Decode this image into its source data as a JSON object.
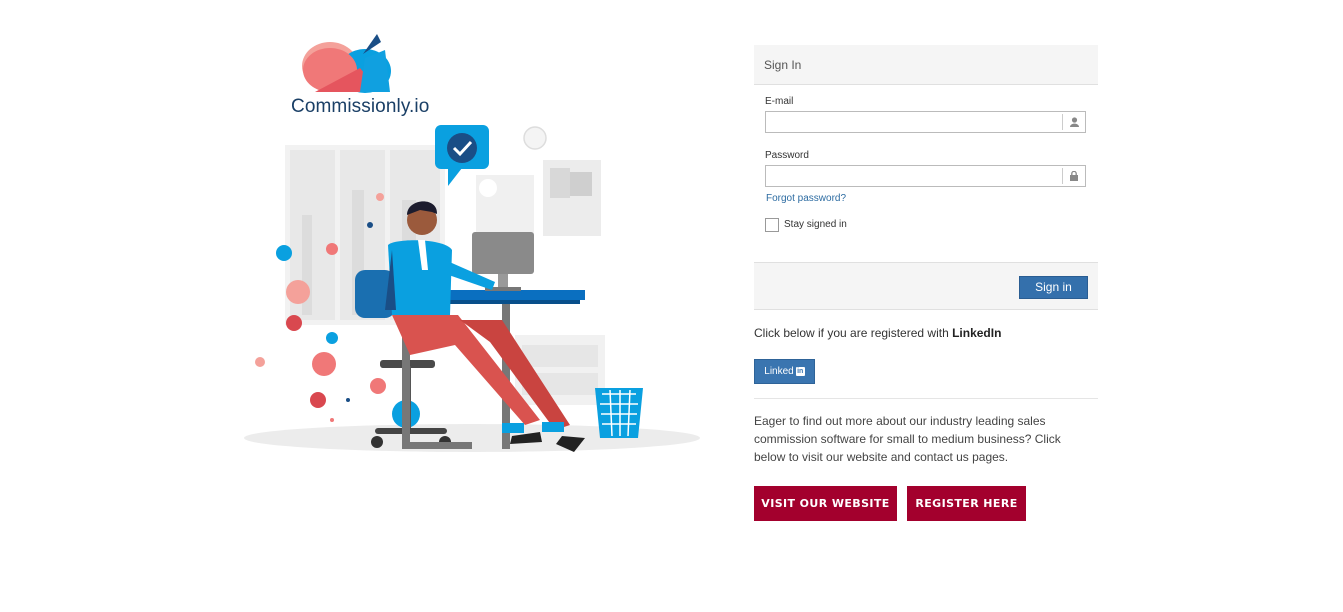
{
  "brand": {
    "name": "Commissionly.io",
    "logo_icon": "cloud-logo-icon"
  },
  "signin": {
    "header": "Sign In",
    "email_label": "E-mail",
    "email_value": "",
    "password_label": "Password",
    "password_value": "",
    "forgot_link": "Forgot password?",
    "stay_signed_in_label": "Stay signed in",
    "stay_signed_in_checked": false,
    "submit_label": "Sign in"
  },
  "linkedin": {
    "prompt_prefix": "Click below if you are registered with ",
    "prompt_bold": "LinkedIn",
    "button_label": "Linked",
    "badge": "in"
  },
  "info": {
    "text": "Eager to find out more about our industry leading sales commission software for small to medium business? Click below to visit our website and contact us pages."
  },
  "actions": {
    "visit_label": "VISIT OUR WEBSITE",
    "register_label": "REGISTER HERE"
  },
  "colors": {
    "primary_blue": "#3470ac",
    "cta_red": "#a3002d",
    "brand_blue": "#0aa0e0",
    "brand_coral": "#f07878"
  }
}
